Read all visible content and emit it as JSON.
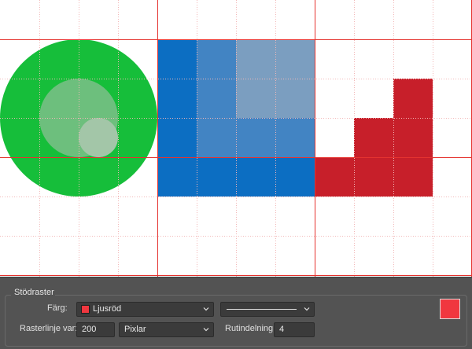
{
  "panel": {
    "title": "Stödraster",
    "color_label": "Färg:",
    "color_value": "Ljusröd",
    "gridline_label": "Rasterlinje var:",
    "gridline_value": "200",
    "units_value": "Pixlar",
    "subdivision_label": "Rutindelning:",
    "subdivision_value": "4",
    "line_style_icon": "solid-line-icon",
    "swatch_color": "#f0373f"
  },
  "colors": {
    "green_circle": "#16be3a",
    "blue": "#0c6ec2",
    "red": "#c71f2a",
    "major_gridline": "#e5332f",
    "minor_gridline": "#f0a4a4",
    "panel_bg": "#535353"
  }
}
